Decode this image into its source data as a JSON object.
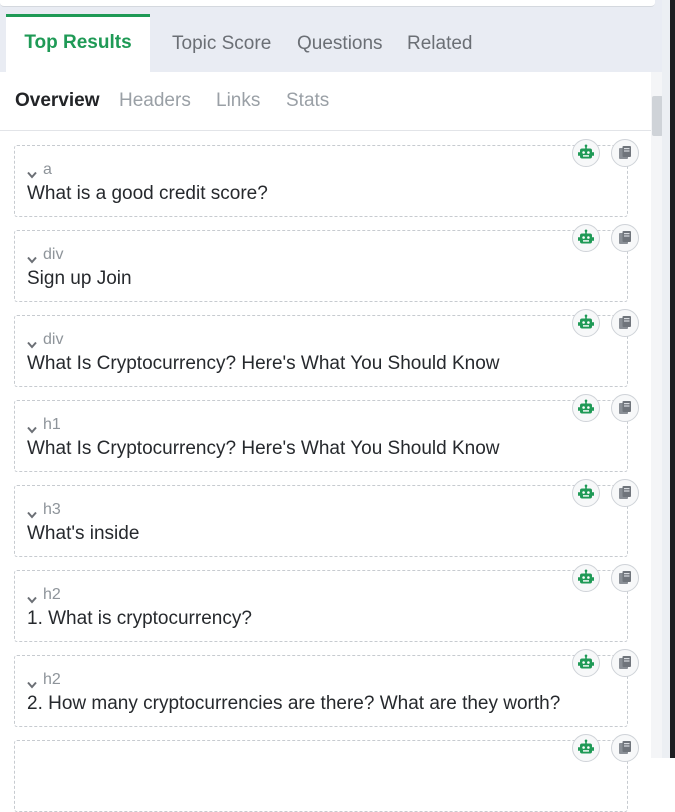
{
  "tabs": [
    {
      "label": "Top Results",
      "active": true
    },
    {
      "label": "Topic Score",
      "active": false
    },
    {
      "label": "Questions",
      "active": false
    },
    {
      "label": "Related",
      "active": false
    }
  ],
  "subtabs": [
    {
      "label": "Overview",
      "active": true
    },
    {
      "label": "Headers",
      "active": false
    },
    {
      "label": "Links",
      "active": false
    },
    {
      "label": "Stats",
      "active": false
    }
  ],
  "cards": [
    {
      "tag": "a",
      "text": "What is a good credit score?"
    },
    {
      "tag": "div",
      "text": "Sign up Join"
    },
    {
      "tag": "div",
      "text": "What Is Cryptocurrency? Here's What You Should Know"
    },
    {
      "tag": "h1",
      "text": "What Is Cryptocurrency? Here's What You Should Know"
    },
    {
      "tag": "h3",
      "text": "What's inside"
    },
    {
      "tag": "h2",
      "text": "1. What is cryptocurrency?"
    },
    {
      "tag": "h2",
      "text": "2. How many cryptocurrencies are there? What are they worth?"
    },
    {
      "tag": "",
      "text": ""
    }
  ],
  "icons": {
    "ai": "robot-icon",
    "copy": "copy-icon"
  },
  "colors": {
    "accent": "#1f9a56",
    "tab_bg": "#e9ecf3"
  }
}
